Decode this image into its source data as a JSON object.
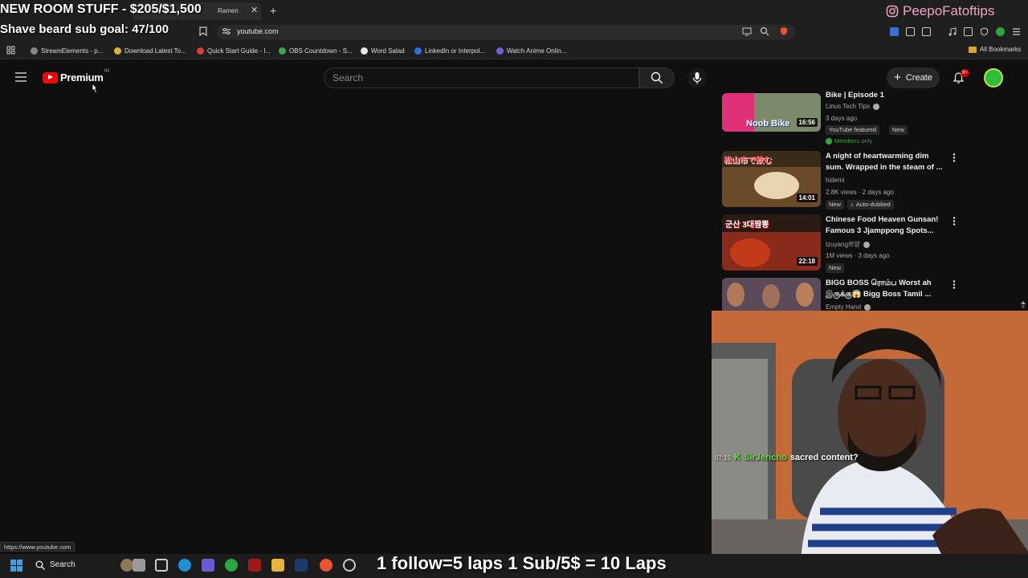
{
  "overlays": {
    "goal": "NEW ROOM STUFF - $205/$1,500",
    "beard": "Shave beard sub goal: 47/100",
    "instagram": "PeepoFatoftips",
    "laps": "1 follow=5 laps 1 Sub/5$ = 10 Laps"
  },
  "browser": {
    "tab_title": "Ramen",
    "url": "youtube.com",
    "status_url": "https://www.youtube.com",
    "bookmarks": [
      {
        "label": "StreamElements - p...",
        "color": "#888888"
      },
      {
        "label": "Download Latest To...",
        "color": "#d9b43a"
      },
      {
        "label": "Quick Start Guide - I...",
        "color": "#e03b3b"
      },
      {
        "label": "OBS Countdown - S...",
        "color": "#3fa34d"
      },
      {
        "label": "Word Salad",
        "color": "#e8e8e8"
      },
      {
        "label": "LinkedIn or Interpol...",
        "color": "#2f6fd6"
      },
      {
        "label": "Watch Anime Onlin...",
        "color": "#7b5cd6"
      }
    ],
    "all_bookmarks": "All Bookmarks"
  },
  "youtube": {
    "logo_text": "Premium",
    "country": "IN",
    "search_placeholder": "Search",
    "create_label": "Create",
    "notification_count": "9+"
  },
  "videos": [
    {
      "title": "Bike | Episode 1",
      "channel": "Linus Tech Tips",
      "meta": "3 days ago",
      "duration": "16:56",
      "thumb_text": "Noob Bike",
      "badges": [
        "YouTube featured",
        "New"
      ],
      "members": "Members only"
    },
    {
      "title": "A night of heartwarming dim sum. Wrapped in the steam of ...",
      "channel": "hidemi",
      "meta": "2.8K views · 2 days ago",
      "duration": "14:01",
      "thumb_text": "松山市で飲む",
      "badges": [
        "New",
        "Auto-dubbed"
      ]
    },
    {
      "title": "Chinese Food Heaven Gunsan! Famous 3 Jjamppong Spots...",
      "channel": "tzuyang쯔양",
      "meta": "1M views · 3 days ago",
      "duration": "22:18",
      "thumb_text": "군산 3대짬뽕",
      "badges": [
        "New"
      ]
    },
    {
      "title": "BIGG BOSS ரொம்ப Worst ah இருக்கு😱 Bigg Boss Tamil ...",
      "channel": "Empty Hand",
      "meta": "",
      "duration": "",
      "thumb_text": "",
      "badges": []
    }
  ],
  "chat": {
    "time": "07:15",
    "user": "SirJericho",
    "message": "sacred content?"
  },
  "taskbar": {
    "search_label": "Search"
  },
  "colors": {
    "yt_red": "#ff0000",
    "background": "#0f0f0f",
    "accent_green": "#2ba640"
  }
}
